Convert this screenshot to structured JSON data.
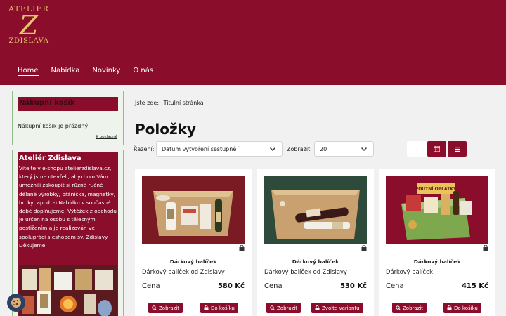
{
  "logo": {
    "line1": "ATELIÉR",
    "letter": "Z",
    "line2": "ZDISLAVA"
  },
  "nav": [
    "Home",
    "Nabídka",
    "Novinky",
    "O nás"
  ],
  "cart": {
    "title": "Nákupní košík",
    "empty": "Nákupní košík je prázdný",
    "link": "K pokladně"
  },
  "about": {
    "title": "Ateliér Zdislava",
    "text": "Vítejte v e-shopu atelierzdislava.cz, který jsme otevřeli, abychom Vám umožnili zakoupit si různé ručně dělané výrobky, přáníčka, magnetky, hrnky, apod.:-) Nabídku v současné době doplňujeme. Výtěžek z obchodu je určen na osobu s tělesným postižením a je realizován ve spolupráci s eshopem sv. Zdislavy. Děkujeme."
  },
  "breadcrumb": {
    "label": "Jste zde:",
    "current": "Titulní stránka"
  },
  "page_title": "Položky",
  "sort": {
    "label": "Řazení:",
    "value": "Datum vytvoření sestupně ˇ"
  },
  "show": {
    "label": "Zobrazit:",
    "value": "20"
  },
  "products": [
    {
      "category": "Dárkový balíček",
      "name": "Dárkový balíček od Zdislavy",
      "price_label": "Cena",
      "price": "580 Kč",
      "btn1": "Zobrazit",
      "btn2": "Do košíku"
    },
    {
      "category": "Dárkový balíček",
      "name": "Dárkový balíček od Zdislavy",
      "price_label": "Cena",
      "price": "530 Kč",
      "btn1": "Zobrazit",
      "btn2": "Zvolte variantu"
    },
    {
      "category": "Dárkový balíček",
      "name": "Dárkový balíček",
      "price_label": "Cena",
      "price": "415 Kč",
      "btn1": "Zobrazit",
      "btn2": "Do košíku"
    }
  ],
  "product3_sign": "POUTNÍ OPLATKY",
  "colors": {
    "brand": "#8b0d2c",
    "gold": "#e6c469",
    "sidebar_bg": "#eef4ec",
    "sidebar_border": "#8fc08a"
  }
}
